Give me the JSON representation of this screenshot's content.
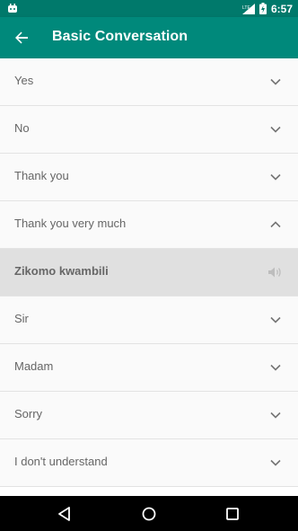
{
  "status_bar": {
    "time": "6:57",
    "network": "LTE"
  },
  "app_bar": {
    "title": "Basic Conversation"
  },
  "items": [
    {
      "label": "Yes",
      "state": "collapsed"
    },
    {
      "label": "No",
      "state": "collapsed"
    },
    {
      "label": "Thank you",
      "state": "collapsed"
    },
    {
      "label": "Thank you very much",
      "state": "expanded"
    },
    {
      "label": "Zikomo kwambili",
      "state": "translation"
    },
    {
      "label": "Sir",
      "state": "collapsed"
    },
    {
      "label": "Madam",
      "state": "collapsed"
    },
    {
      "label": "Sorry",
      "state": "collapsed"
    },
    {
      "label": "I don't understand",
      "state": "collapsed"
    }
  ],
  "colors": {
    "app_bar": "#00897b",
    "status_bar": "#00796b",
    "highlight_row": "#e0e0e0"
  }
}
